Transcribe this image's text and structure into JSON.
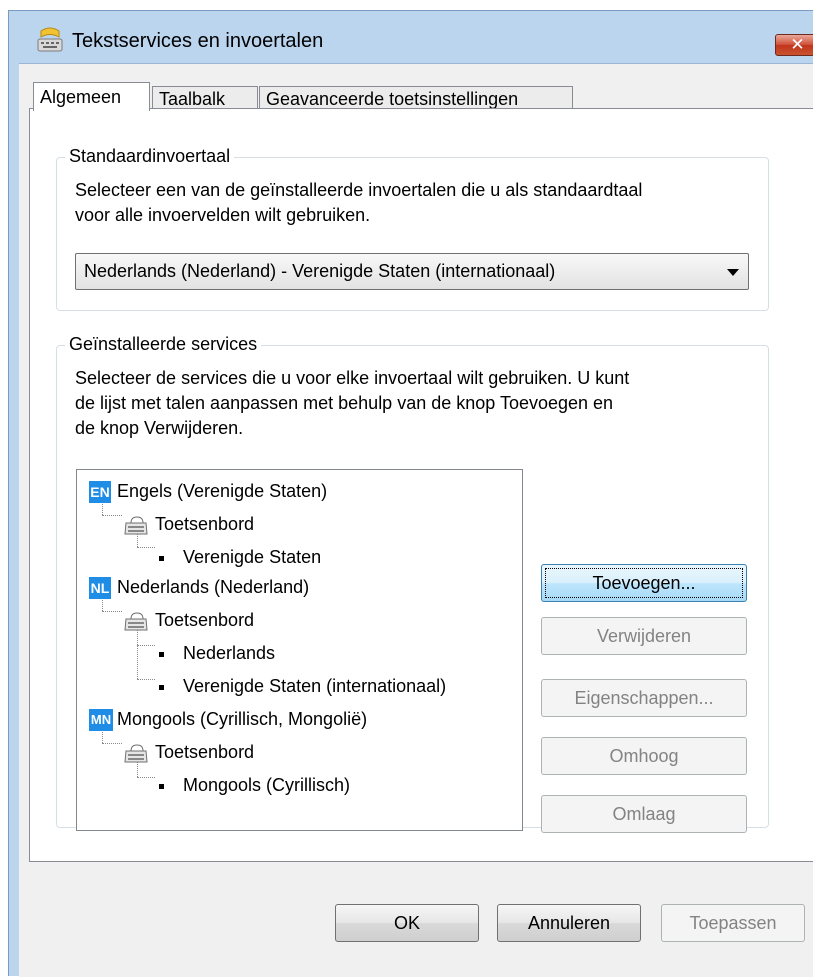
{
  "window": {
    "title": "Tekstservices en invoertalen",
    "close_label": "✕"
  },
  "tabs": [
    {
      "label": "Algemeen",
      "active": true
    },
    {
      "label": "Taalbalk",
      "active": false
    },
    {
      "label": "Geavanceerde toetsinstellingen",
      "active": false
    }
  ],
  "default_language": {
    "group_label": "Standaardinvoertaal",
    "description_line1": "Selecteer een van de geïnstalleerde invoertalen die u als standaardtaal",
    "description_line2": "voor alle invoervelden wilt gebruiken.",
    "selected_value": "Nederlands (Nederland) - Verenigde Staten (internationaal)"
  },
  "installed_services": {
    "group_label": "Geïnstalleerde services",
    "description_line1": "Selecteer de services die u voor elke invoertaal wilt gebruiken. U kunt",
    "description_line2": "de lijst met talen aanpassen met behulp van de knop Toevoegen en",
    "description_line3": "de knop Verwijderen.",
    "languages": [
      {
        "code": "EN",
        "name": "Engels (Verenigde Staten)",
        "category": "Toetsenbord",
        "layouts": [
          "Verenigde Staten"
        ]
      },
      {
        "code": "NL",
        "name": "Nederlands (Nederland)",
        "category": "Toetsenbord",
        "layouts": [
          "Nederlands",
          "Verenigde Staten (internationaal)"
        ]
      },
      {
        "code": "MN",
        "name": "Mongools (Cyrillisch, Mongolië)",
        "category": "Toetsenbord",
        "layouts": [
          "Mongools (Cyrillisch)"
        ]
      }
    ],
    "buttons": {
      "add": "Toevoegen...",
      "remove": "Verwijderen",
      "properties": "Eigenschappen...",
      "move_up": "Omhoog",
      "move_down": "Omlaag"
    }
  },
  "footer": {
    "ok": "OK",
    "cancel": "Annuleren",
    "apply": "Toepassen"
  },
  "colors": {
    "accent": "#1f8ce6",
    "frame": "#bcd5ef",
    "close": "#c1341c"
  }
}
